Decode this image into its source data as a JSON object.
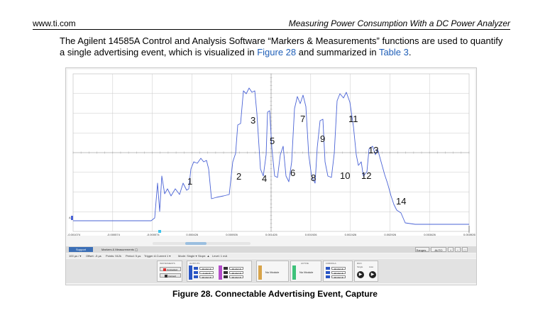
{
  "header": {
    "site": "www.ti.com",
    "doc_title": "Measuring Power Consumption With a DC Power Analyzer"
  },
  "paragraph": {
    "text1": "The Agilent 14585A Control and Analysis Software “Markers & Measurements” functions are used to quantify a single advertising event, which is visualized in ",
    "link1": "Figure 28",
    "text2": " and summarized in ",
    "link2": "Table 3",
    "text3": "."
  },
  "scope": {
    "marker_label": "A",
    "x_ticks": [
      "-0.001074",
      "-0.000574",
      "-0.000074",
      "0.000426",
      "0.000926",
      "0.001426",
      "0.001926",
      "0.002426",
      "0.002926",
      "0.003426",
      "0.003926"
    ],
    "segment_labels": [
      "1",
      "2",
      "3",
      "4",
      "5",
      "6",
      "7",
      "8",
      "9",
      "10",
      "11",
      "12",
      "13",
      "14"
    ]
  },
  "controls": {
    "tab_support": "Support",
    "tab_markers": "Markers & Measurements",
    "ranges_button": "Ranges...",
    "autoscale_button": "AUTO SCALE",
    "row2": {
      "timebase": "100 µs / ▾",
      "offset": "Offset: -5 µs",
      "points": "Points: 512k",
      "period": "Period: 5 µs",
      "trigger_label": "Trigger:",
      "trigger_source": "A Current 1 ▾",
      "mode": "Mode: Single ▾",
      "slope": "Slope: ▲",
      "level": "Level: 1 mA"
    },
    "instruments_title": "INSTRUMENTS",
    "connected_label": "Connected",
    "connect_label": "Connect",
    "outputs_title": "OUTPUTS",
    "output_values": [
      "10 mV / ▾",
      "1 mA / ▾",
      "10 mV / ▾",
      "10 mV / ▾",
      "10 mV / ▾",
      "10 mV / ▾"
    ],
    "active_title": "ACTIVE",
    "no_module_1": "No Module",
    "no_module_2": "No Module",
    "formula_title": "FORMULA",
    "formula_values": [
      "10 mV / ▾",
      "10 mV / ▾",
      "10 mV / ▾"
    ],
    "run_title": "RUN",
    "single_label": "Single",
    "auto_label": "Auto"
  },
  "caption": "Figure 28. Connectable Advertising Event, Capture",
  "colors": {
    "trace": "#4a63d6",
    "grid": "#c8c8c8",
    "link": "#1f5fb8",
    "cyan_marker": "#3ac4ee"
  }
}
